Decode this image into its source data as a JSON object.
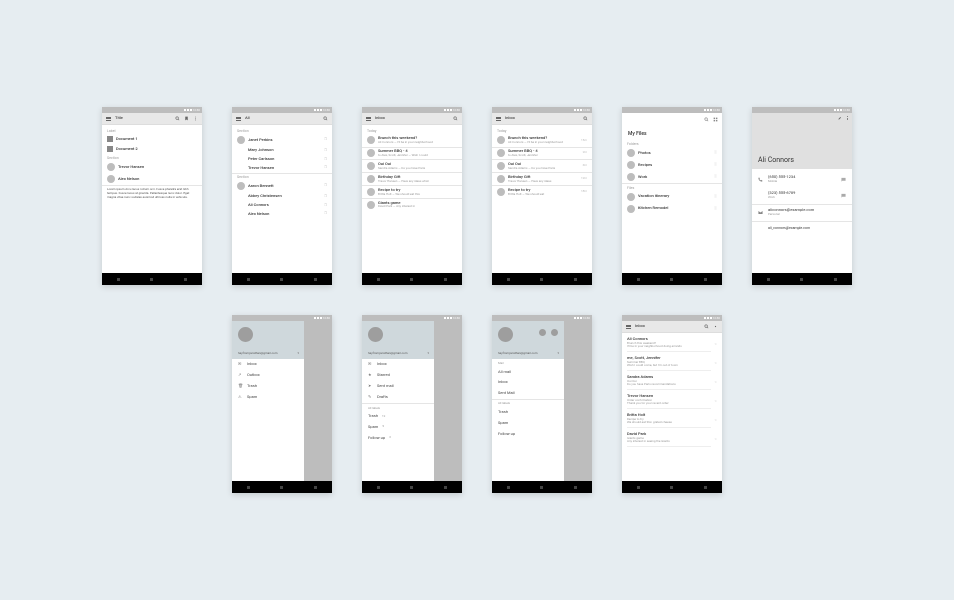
{
  "status": {
    "time": "12:30"
  },
  "screen1": {
    "title": "Title",
    "section1": "Label",
    "docs": [
      "Document 1",
      "Document 2"
    ],
    "section2": "Section",
    "people": [
      "Trevor Hansen",
      "Alex Nelson"
    ],
    "lorem": "Lorem ipsum Arcu lacus rutrum orci. Fusce pharetra erat nibh tempus. Fusce lacus at gravida. Pellentesque nunc dolor. Eget magna vitae nunc sodales euismod ultrices nulla in vehicula."
  },
  "screen2": {
    "title": "All",
    "section1": "Section",
    "listA": [
      "Janet Perkins",
      "Mary Johnson",
      "Peter Carlsson",
      "Trevor Hansen"
    ],
    "section2": "Section",
    "listB": [
      "Aaron Bennett",
      "Abbey Christensen",
      "Ali Connors",
      "Alex Nelson"
    ]
  },
  "screen3": {
    "title": "Inbox",
    "section": "Today",
    "items": [
      {
        "t": "Brunch this weekend?",
        "s": "Ali Connors — I'll be in your neighborhood"
      },
      {
        "t": "Summer BBQ - 4",
        "s": "to Alex, Scott, Jennifer — Wish I could"
      },
      {
        "t": "Oui Oui",
        "s": "Sandra Adams — Do you have Paris"
      },
      {
        "t": "Birthday Gift",
        "s": "Trevor Hansen — Have any ideas what"
      },
      {
        "t": "Recipe to try",
        "s": "Britta Holt — We should eat this"
      },
      {
        "t": "Giants game",
        "s": "David Park — Any interest in"
      }
    ]
  },
  "screen4": {
    "title": "Inbox",
    "section": "Today",
    "items": [
      {
        "t": "Brunch this weekend?",
        "s": "Ali Connors — I'll be in your neighborhood",
        "d": "15m"
      },
      {
        "t": "Summer BBQ - 4",
        "s": "to Alex, Scott, Jennifer",
        "d": "2hr"
      },
      {
        "t": "Oui Oui",
        "s": "Sandra Adams — Do you have Paris",
        "d": "6hr"
      },
      {
        "t": "Birthday Gift",
        "s": "Trevor Hansen — Have any ideas",
        "d": "12hr"
      },
      {
        "t": "Recipe to try",
        "s": "Britta Holt — We should eat",
        "d": "18hr"
      }
    ]
  },
  "screen5": {
    "title": "My Files",
    "section1": "Folders",
    "folders": [
      "Photos",
      "Recipes",
      "Work"
    ],
    "section2": "Files",
    "files": [
      "Vacation itinerary",
      "Kitchen Remodel"
    ]
  },
  "screen6": {
    "name": "Ali Connors",
    "phones": [
      {
        "n": "(650) 555-1234",
        "l": "Mobile"
      },
      {
        "n": "(323) 555-6789",
        "l": "Work"
      }
    ],
    "email": {
      "n": "aliconnors@example.com",
      "l": "Personal"
    },
    "email2": {
      "n": "ali_connors@example.com",
      "l": ""
    }
  },
  "drawer1": {
    "email": "heyfromjonathan@gmail.com",
    "items": [
      {
        "l": "Inbox"
      },
      {
        "l": "Outbox"
      },
      {
        "l": "Trash"
      },
      {
        "l": "Spam"
      }
    ]
  },
  "drawer2": {
    "email": "heyfromjonathan@gmail.com",
    "items": [
      {
        "l": "Inbox"
      },
      {
        "l": "Starred"
      },
      {
        "l": "Sent mail"
      },
      {
        "l": "Drafts"
      }
    ],
    "sect": "All labels",
    "items2": [
      "Trash",
      "Spam",
      "Follow up"
    ]
  },
  "drawer3": {
    "email": "heyfromjonathan@gmail.com",
    "sectA": "Mail",
    "itemsA": [
      "All mail",
      "Inbox",
      "Sent Mail"
    ],
    "sectB": "All labels",
    "itemsB": [
      "Trash",
      "Spam",
      "Follow up"
    ]
  },
  "screen10": {
    "title": "Inbox",
    "items": [
      {
        "f": "Ali Connors",
        "t": "Brunch this weekend?",
        "s": "I'll be in your neighborhood doing errands"
      },
      {
        "f": "me, Scott, Jennifer",
        "t": "Summer BBQ",
        "s": "Wish I could come, but I'm out of town"
      },
      {
        "f": "Sandra Adams",
        "t": "Oui Oui",
        "s": "Do you have Paris recommendations"
      },
      {
        "f": "Trevor Hansen",
        "t": "Order confirmation",
        "s": "Thank you for your recent order"
      },
      {
        "f": "Britta Holt",
        "t": "Recipe to try",
        "s": "We should eat this: grated cheese"
      },
      {
        "f": "David Park",
        "t": "Giants game",
        "s": "Any interest in seeing the Giants"
      }
    ]
  }
}
